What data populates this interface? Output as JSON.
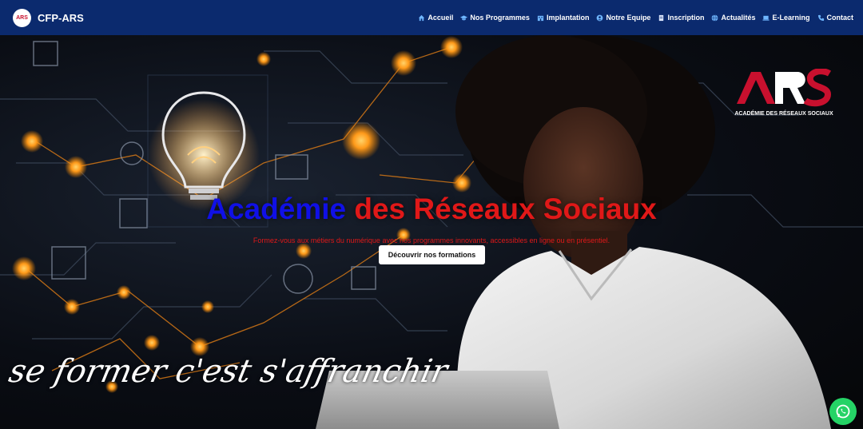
{
  "navbar": {
    "brand_logo_text": "ARS",
    "brand_name": "CFP-ARS",
    "items": [
      {
        "label": "Accueil",
        "icon": "home-icon"
      },
      {
        "label": "Nos Programmes",
        "icon": "graduation-icon"
      },
      {
        "label": "Implantation",
        "icon": "building-icon"
      },
      {
        "label": "Notre Equipe",
        "icon": "team-icon"
      },
      {
        "label": "Inscription",
        "icon": "form-icon"
      },
      {
        "label": "Actualités",
        "icon": "globe-icon"
      },
      {
        "label": "E-Learning",
        "icon": "laptop-icon"
      },
      {
        "label": "Contact",
        "icon": "phone-icon"
      }
    ]
  },
  "hero": {
    "title_part1": "Académie",
    "title_part2": "des Réseaux Sociaux",
    "subtitle": "Formez-vous aux métiers du numérique avec nos programmes innovants, accessibles en ligne ou en présentiel.",
    "cta_label": "Découvrir nos formations",
    "tagline": "se former c'est s'affranchir",
    "logo_text": "ARS",
    "logo_subtext": "ACADÉMIE DES RÉSEAUX SOCIAUX"
  },
  "colors": {
    "navbar": "#0b2a6e",
    "title_blue": "#1010e6",
    "title_red": "#e01818",
    "whatsapp": "#25d366"
  }
}
